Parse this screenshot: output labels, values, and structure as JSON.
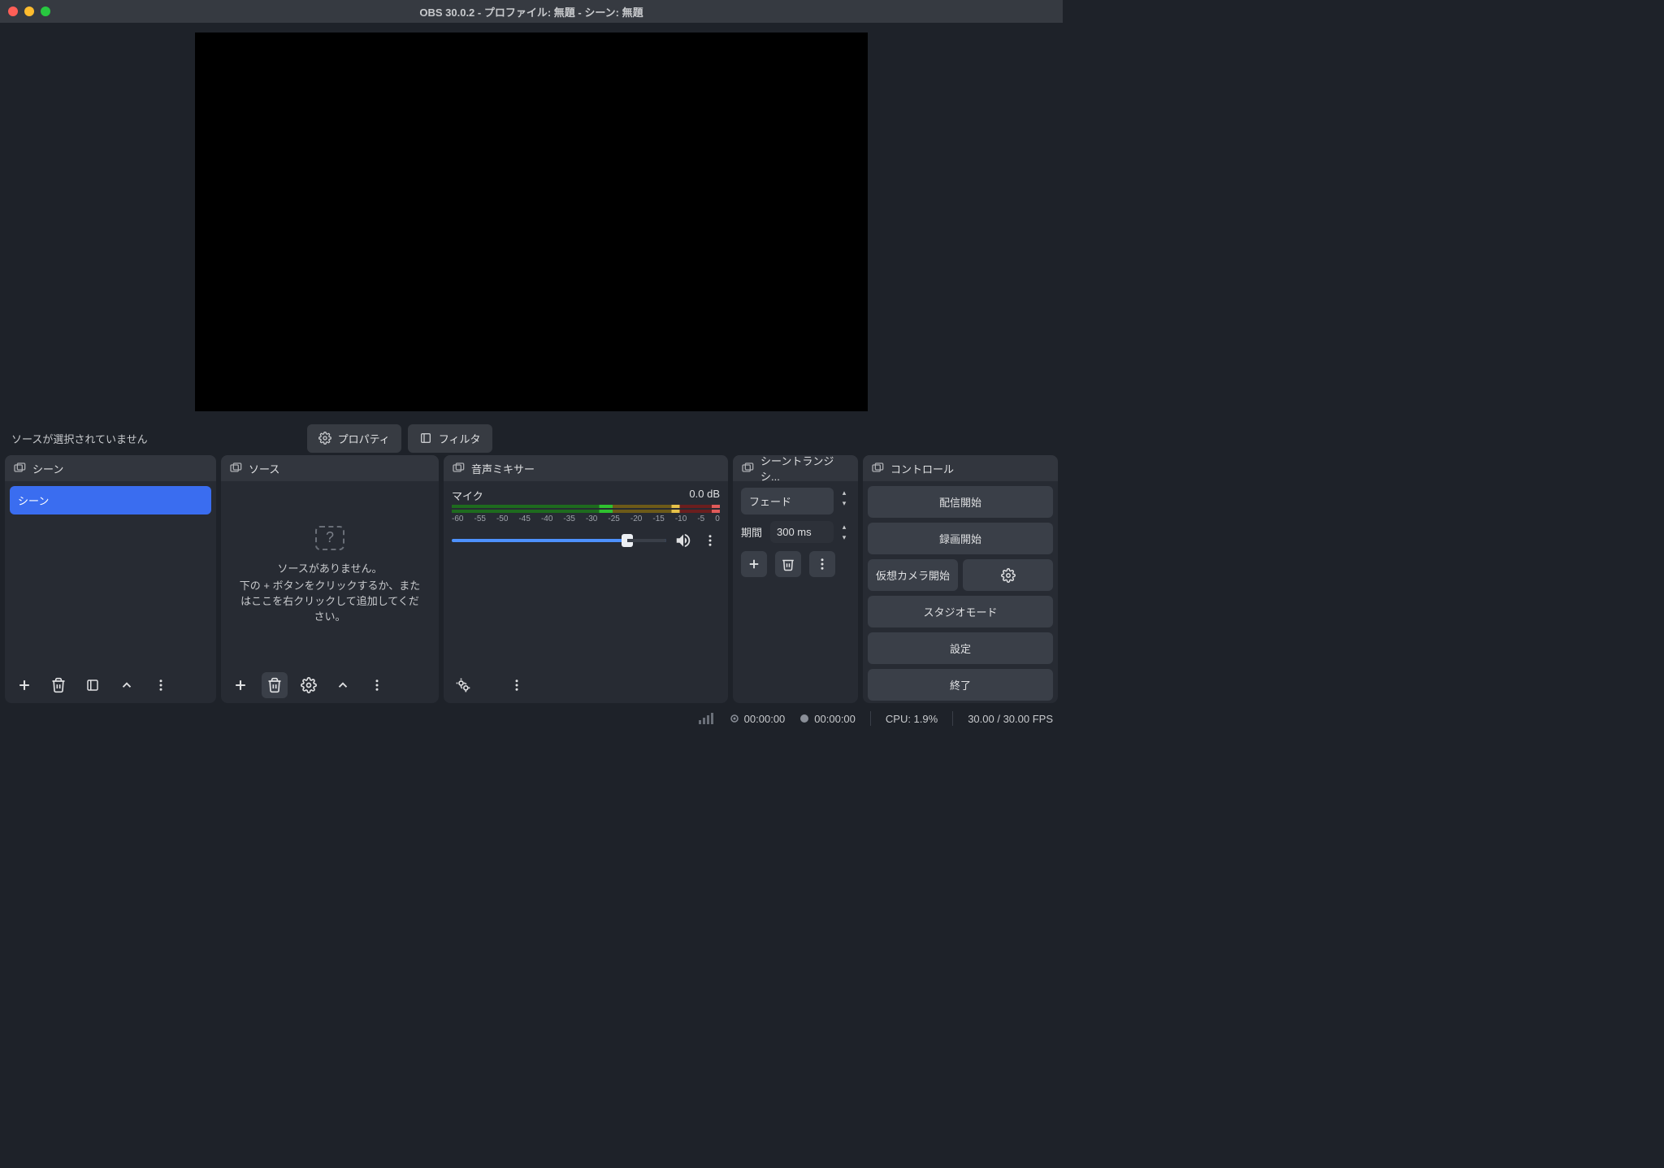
{
  "window": {
    "title": "OBS 30.0.2 - プロファイル: 無題 - シーン: 無題"
  },
  "toolbar": {
    "status_text": "ソースが選択されていません",
    "properties_label": "プロパティ",
    "filters_label": "フィルタ"
  },
  "panels": {
    "scenes": {
      "title": "シーン",
      "items": [
        "シーン"
      ]
    },
    "sources": {
      "title": "ソース",
      "empty_line1": "ソースがありません。",
      "empty_line2": "下の + ボタンをクリックするか、またはここを右クリックして追加してください。"
    },
    "mixer": {
      "title": "音声ミキサー",
      "channel_name": "マイク",
      "channel_db": "0.0 dB",
      "ticks": [
        "-60",
        "-55",
        "-50",
        "-45",
        "-40",
        "-35",
        "-30",
        "-25",
        "-20",
        "-15",
        "-10",
        "-5",
        "0"
      ]
    },
    "transitions": {
      "title": "シーントランジシ...",
      "selected": "フェード",
      "duration_label": "期間",
      "duration_value": "300 ms"
    },
    "controls": {
      "title": "コントロール",
      "start_stream": "配信開始",
      "start_record": "録画開始",
      "start_virtualcam": "仮想カメラ開始",
      "studio_mode": "スタジオモード",
      "settings": "設定",
      "exit": "終了"
    }
  },
  "status": {
    "stream_time": "00:00:00",
    "record_time": "00:00:00",
    "cpu": "CPU: 1.9%",
    "fps": "30.00 / 30.00 FPS"
  }
}
